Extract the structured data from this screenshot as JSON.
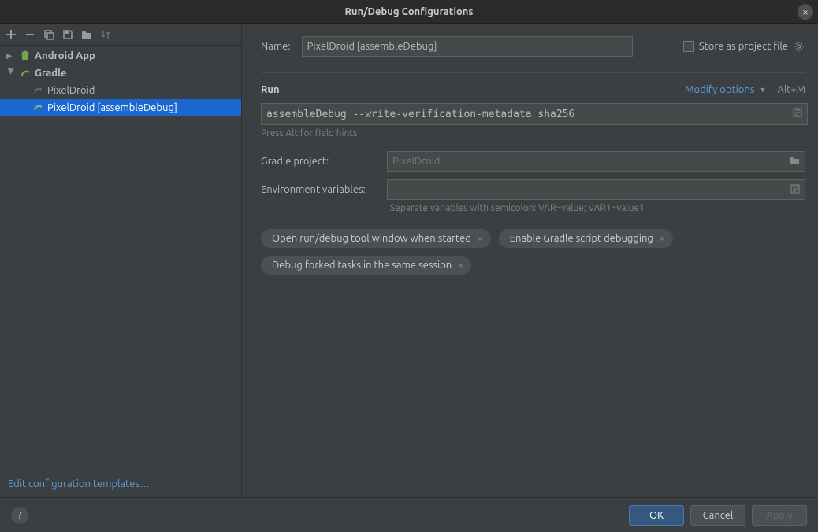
{
  "titlebar": {
    "title": "Run/Debug Configurations"
  },
  "toolbar": {
    "add": "+",
    "remove": "−"
  },
  "tree": {
    "android": {
      "label": "Android App"
    },
    "gradle": {
      "label": "Gradle"
    },
    "items": [
      {
        "label": "PixelDroid"
      },
      {
        "label": "PixelDroid [assembleDebug]"
      }
    ]
  },
  "sidebar": {
    "edit_templates": "Edit configuration templates…"
  },
  "form": {
    "name_label": "Name:",
    "name_value": "PixelDroid [assembleDebug]",
    "store_label": "Store as project file",
    "run_title": "Run",
    "modify_label": "Modify options",
    "shortcut": "Alt+M",
    "command": "assembleDebug --write-verification-metadata sha256",
    "hint": "Press Alt for field hints",
    "gradle_label": "Gradle project:",
    "gradle_value": "PixelDroid",
    "env_label": "Environment variables:",
    "env_value": "",
    "env_helper": "Separate variables with semicolon: VAR=value; VAR1=value1",
    "tags": [
      "Open run/debug tool window when started",
      "Enable Gradle script debugging",
      "Debug forked tasks in the same session"
    ]
  },
  "footer": {
    "ok": "OK",
    "cancel": "Cancel",
    "apply": "Apply"
  }
}
